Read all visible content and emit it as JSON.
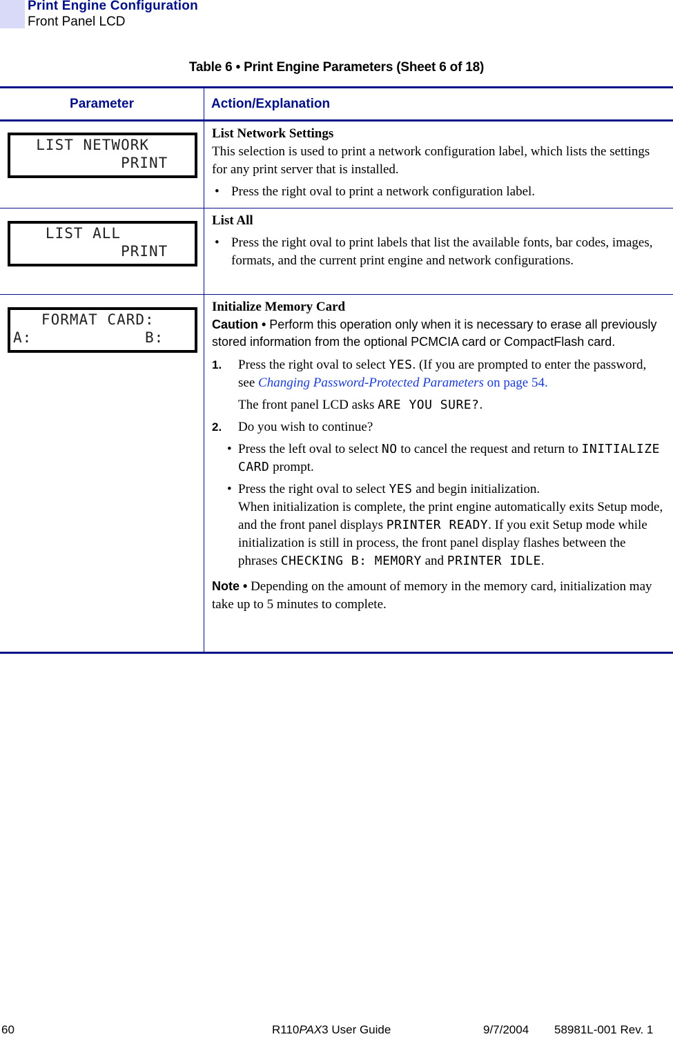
{
  "header": {
    "title": "Print Engine Configuration",
    "subtitle": "Front Panel LCD"
  },
  "table": {
    "caption": "Table 6 • Print Engine Parameters (Sheet 6 of 18)",
    "columns": [
      "Parameter",
      "Action/Explanation"
    ],
    "rows": [
      {
        "lcd": {
          "line1": "  LIST NETWORK",
          "line2": "           PRINT"
        },
        "title": "List Network Settings",
        "description": "This selection is used to print a network configuration label, which lists the settings for any print server that is installed.",
        "bullets": [
          "Press the right oval to print a network configuration label."
        ]
      },
      {
        "lcd": {
          "line1": "   LIST ALL",
          "line2": "           PRINT"
        },
        "title": "List All",
        "bullets": [
          "Press the right oval to print labels that list the available fonts, bar codes, images, formats, and the current print engine and network configurations."
        ]
      },
      {
        "lcd": {
          "line1": "   FORMAT CARD:",
          "line2": "A:            B:"
        },
        "title": "Initialize Memory Card",
        "caution_label": "Caution •",
        "caution_text": " Perform this operation only when it is necessary to erase all previously stored information from the optional PCMCIA card or CompactFlash card.",
        "step1": {
          "num": "1.",
          "pre": "Press the right oval to select ",
          "code": "YES",
          "mid": ". (If you are prompted to enter the password, see ",
          "link": "Changing Password-Protected Parameters",
          "post": " on page 54.",
          "follow_pre": "The front panel LCD asks ",
          "follow_code": "ARE YOU SURE?",
          "follow_post": "."
        },
        "step2": {
          "num": "2.",
          "text": "Do you wish to continue?",
          "bullet1": {
            "pre": "Press the left oval to select ",
            "code1": "NO",
            "mid": " to cancel the request and return to ",
            "code2": "INITIALIZE CARD",
            "post": " prompt."
          },
          "bullet2": {
            "pre": "Press the right oval to select ",
            "code1": "YES",
            "mid": " and begin initialization.",
            "line2": "When initialization is complete, the print engine automatically exits Setup mode, and the front panel displays ",
            "code2": "PRINTER READY",
            "mid2": ". If you exit Setup mode while initialization is still in process, the front panel display flashes between the phrases ",
            "code3": "CHECKING B: MEMORY",
            "and": " and ",
            "code4": "PRINTER IDLE",
            "post": "."
          }
        },
        "note_label": "Note •",
        "note_text": " Depending on the amount of memory in the memory card, initialization may take up to 5 minutes to complete."
      }
    ]
  },
  "footer": {
    "page": "60",
    "guide_pre": "R110",
    "guide_italic": "PAX",
    "guide_post": "3 User Guide",
    "date": "9/7/2004",
    "doc_id": "58981L-001 Rev. 1"
  }
}
